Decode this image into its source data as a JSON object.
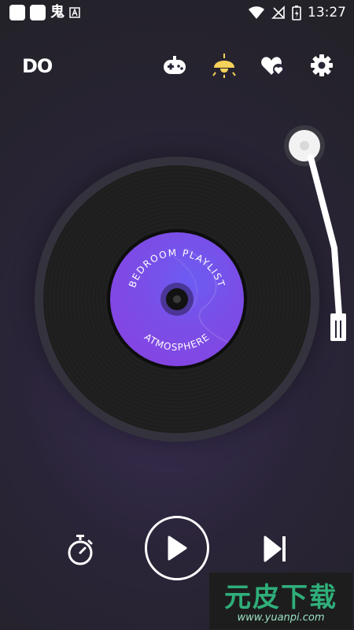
{
  "status_bar": {
    "glyph_1": "鬼",
    "time": "13:27",
    "icons": [
      "square-notification-icon",
      "square-notification-icon",
      "app-notification-icon",
      "a-badge-icon",
      "wifi-icon",
      "no-signal-icon",
      "battery-charging-icon"
    ]
  },
  "header": {
    "logo": "DO",
    "buttons": [
      "gamepad-icon",
      "lamp-icon",
      "heart-icon",
      "settings-icon"
    ]
  },
  "record": {
    "label_top_text": "BEDROOM PLAYLIST",
    "label_bottom_text": "ATMOSPHERE",
    "label_colors": [
      "#6c5cf2",
      "#8a3fe0"
    ]
  },
  "controls": {
    "timer": "timer-icon",
    "play": "play-icon",
    "next": "skip-next-icon"
  },
  "watermark": {
    "title": "元皮下载",
    "url": "www.yuanpi.com"
  },
  "colors": {
    "accent_lamp": "#f5d25a",
    "background": "#2a2438",
    "watermark_green": "#2fae7a"
  }
}
